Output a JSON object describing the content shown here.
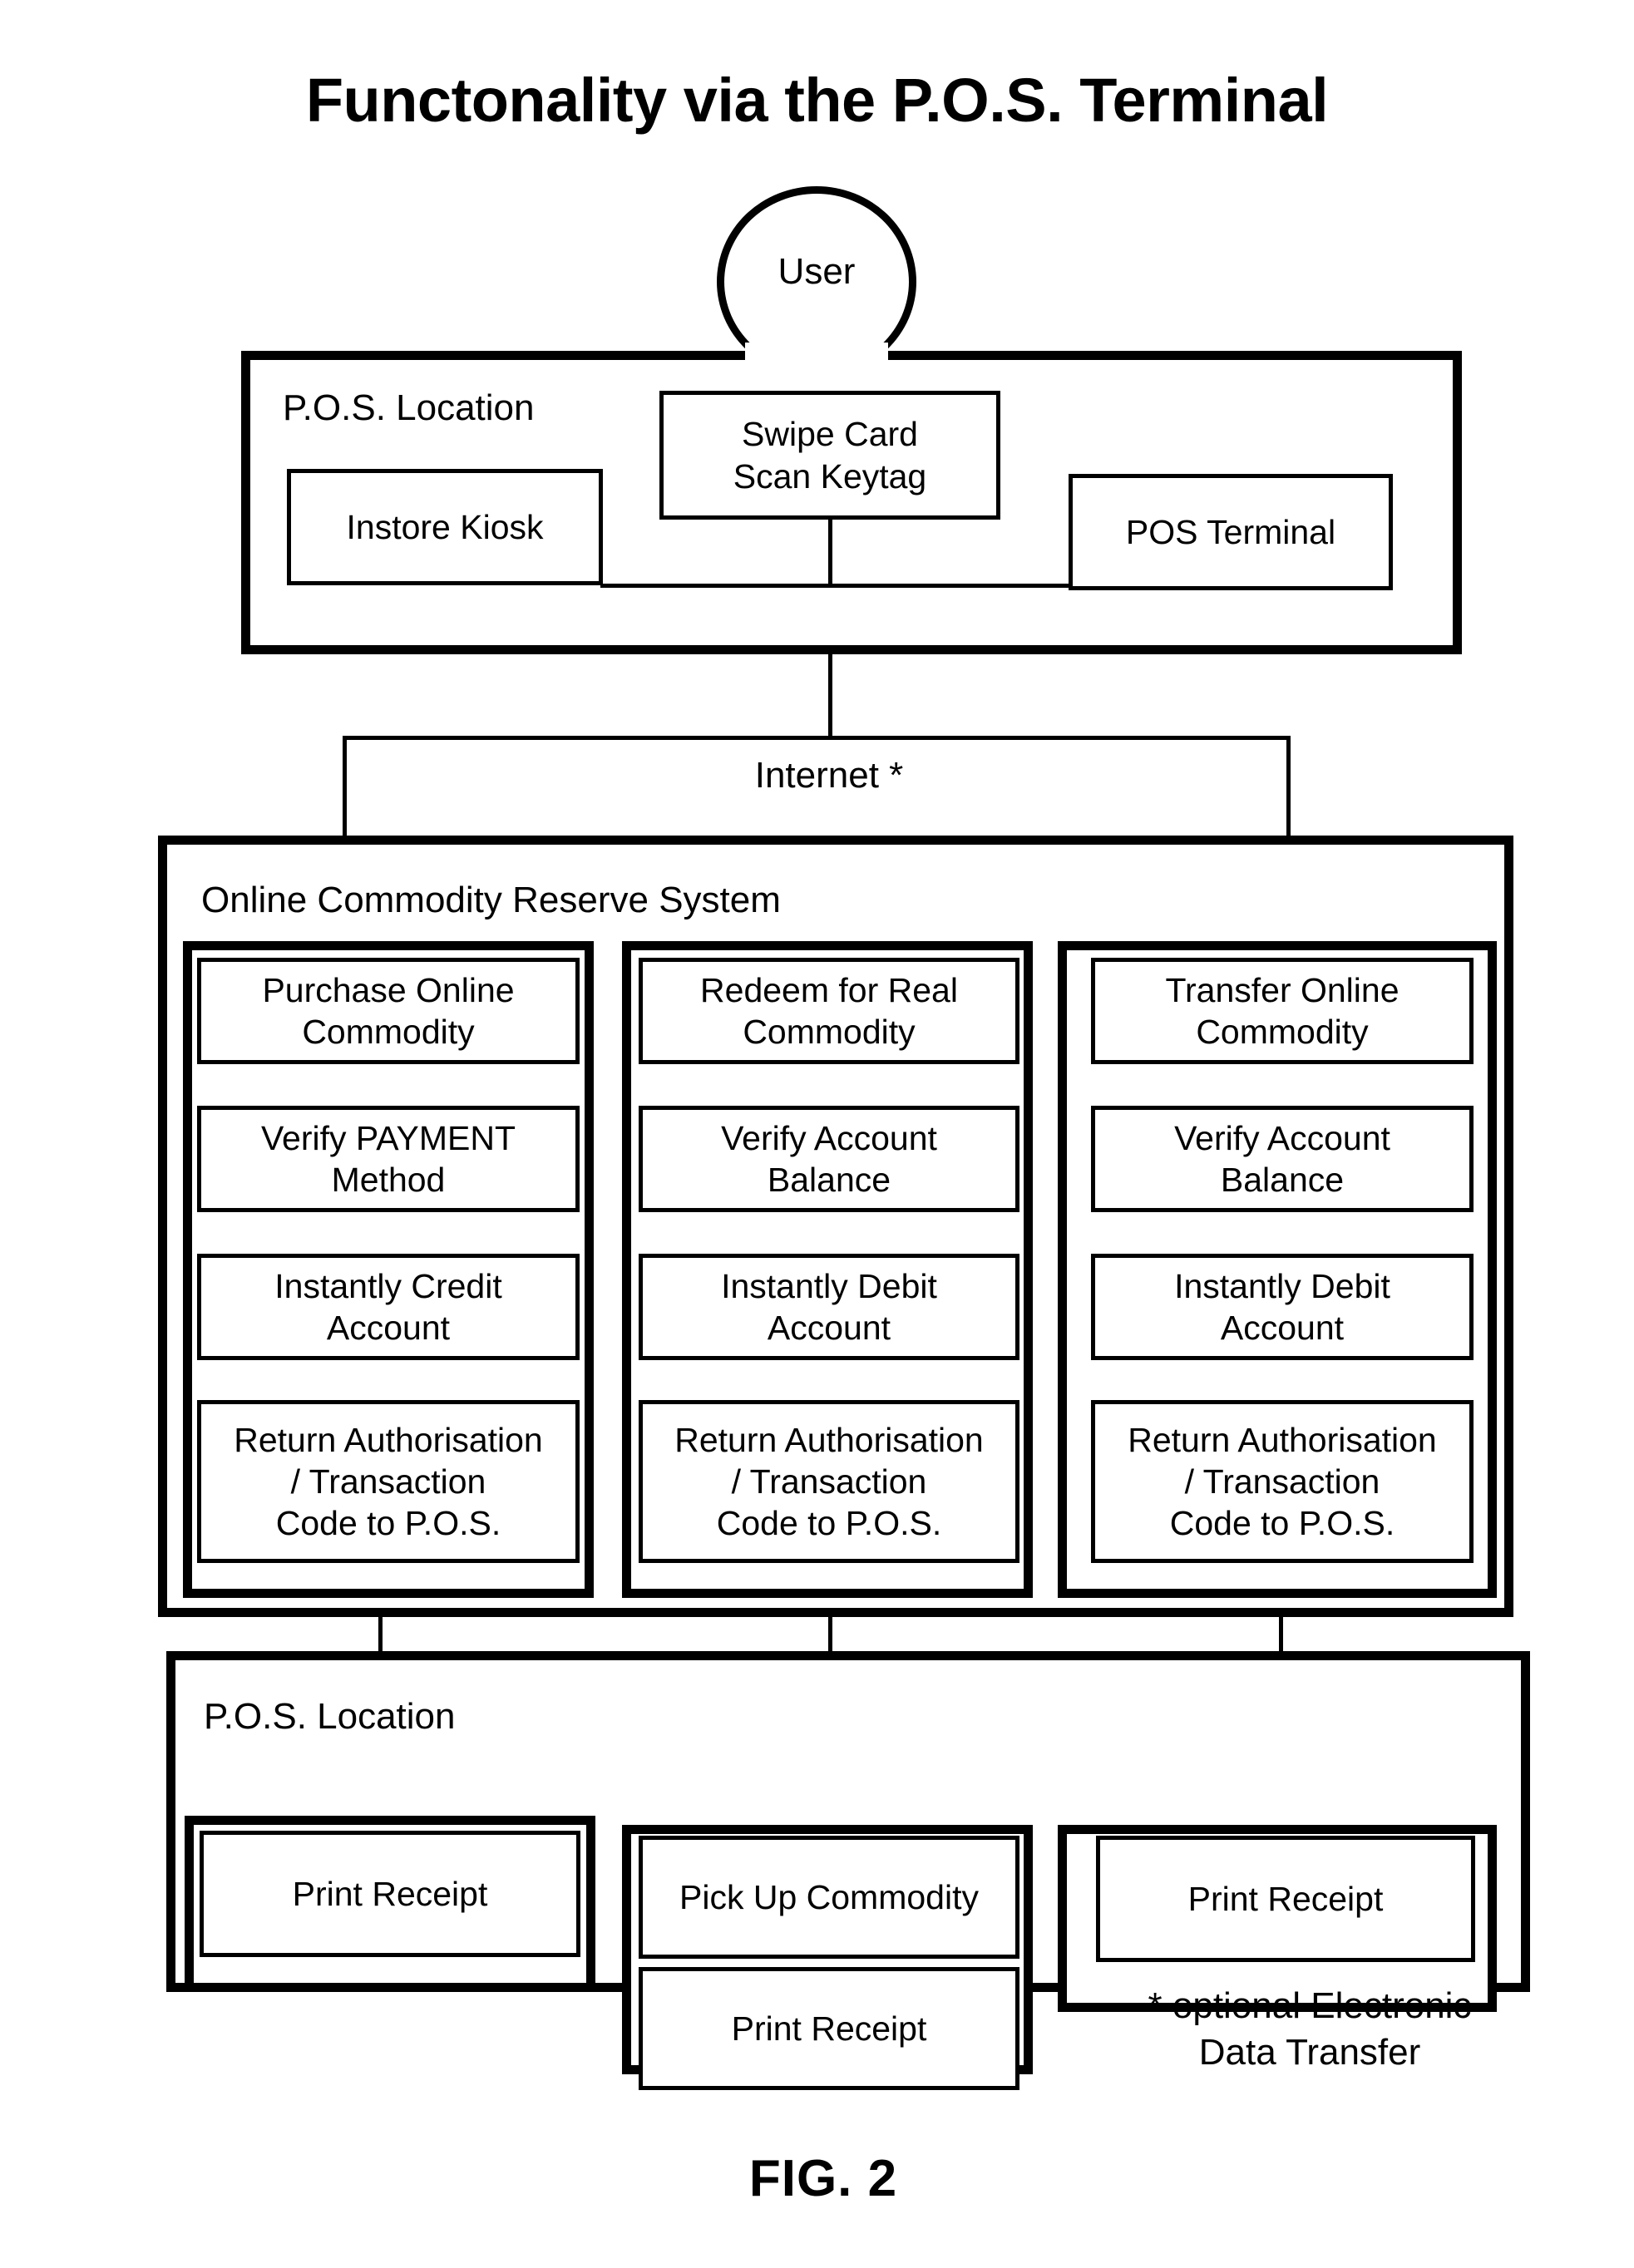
{
  "figure": {
    "title": "Functonality via the P.O.S. Terminal",
    "fig_label": "FIG. 2",
    "footnote": "* optional Electronic\nData Transfer"
  },
  "actor": {
    "label": "User"
  },
  "pos_top": {
    "section_title": "P.O.S. Location",
    "boxes": {
      "kiosk": "Instore Kiosk",
      "swipe": "Swipe Card\nScan Keytag",
      "terminal": "POS Terminal"
    }
  },
  "internet": {
    "label": "Internet *"
  },
  "system": {
    "section_title": "Online Commodity Reserve System",
    "columns": [
      {
        "name": "purchase-column",
        "steps": [
          "Purchase Online\nCommodity",
          "Verify PAYMENT\nMethod",
          "Instantly Credit\nAccount",
          "Return Authorisation\n/ Transaction\nCode to P.O.S."
        ]
      },
      {
        "name": "redeem-column",
        "steps": [
          "Redeem for Real\nCommodity",
          "Verify Account\nBalance",
          "Instantly Debit\nAccount",
          "Return Authorisation\n/ Transaction\nCode to P.O.S."
        ]
      },
      {
        "name": "transfer-column",
        "steps": [
          "Transfer Online\nCommodity",
          "Verify Account\nBalance",
          "Instantly Debit\nAccount",
          "Return Authorisation\n/ Transaction\nCode to P.O.S."
        ]
      }
    ]
  },
  "pos_bottom": {
    "section_title": "P.O.S. Location",
    "columns": [
      {
        "name": "purchase-outcome",
        "steps": [
          "Print Receipt"
        ]
      },
      {
        "name": "redeem-outcome",
        "steps": [
          "Pick Up Commodity",
          "Print Receipt"
        ]
      },
      {
        "name": "transfer-outcome",
        "steps": [
          "Print Receipt"
        ]
      }
    ]
  }
}
